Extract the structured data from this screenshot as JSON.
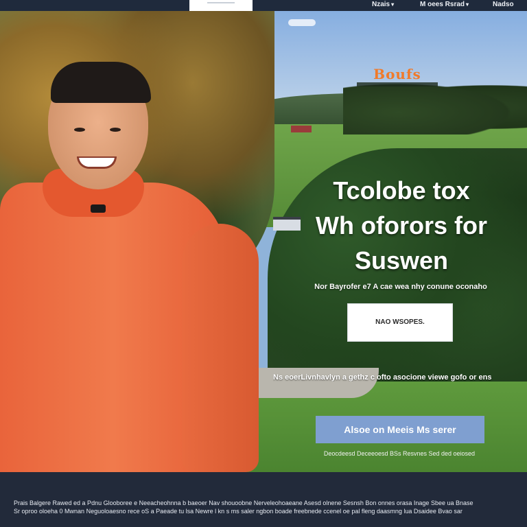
{
  "nav": {
    "items": [
      {
        "label": "Nzais",
        "icon": "chevron-down-icon"
      },
      {
        "label": "M oees Rsrad",
        "icon": "chevron-down-icon"
      },
      {
        "label": "Nadso",
        "icon": ""
      }
    ]
  },
  "hero": {
    "brand": "Boufs",
    "title_lines": [
      "Tcolobe tox",
      "Wh oforors for",
      "Suswen"
    ],
    "subtitle": "Nor Bayrofer e7 A cae wea nhy conune oconaho",
    "primary_cta": "NAO WSOPES.",
    "description": "Ns eoerLivnhavlyn a gethz c ofto asocione viewe gofo or ens",
    "secondary_cta": "Alsoe on Meeis Ms serer",
    "note": "Deocdeesd Deceeoesd BSs Resvnes Sed ded oeiosed"
  },
  "footer": {
    "line1": "Prais Balgere Rawed ed a Pdnu Glooboree e Neeacheohnna b baeoer Nav shouoobne Nerveleohoaeane Asesd olnene Sesnsh Bon onnes orasa Inage Sbee ua Bnase",
    "line2": "Sr oproo oloeha 0 Mwnan Neguoloaesno rece oS a Paeade tu lsa Newre l kn s ms saler ngbon boade freebnede ccenel oe pal fleng daasmng lua Dsaidee Bvao sar"
  },
  "colors": {
    "nav_bg": "#1f2a3c",
    "sweater": "#f07a4c",
    "cta_secondary": "#7f9fd0",
    "brand_orange": "#f07a2a"
  }
}
